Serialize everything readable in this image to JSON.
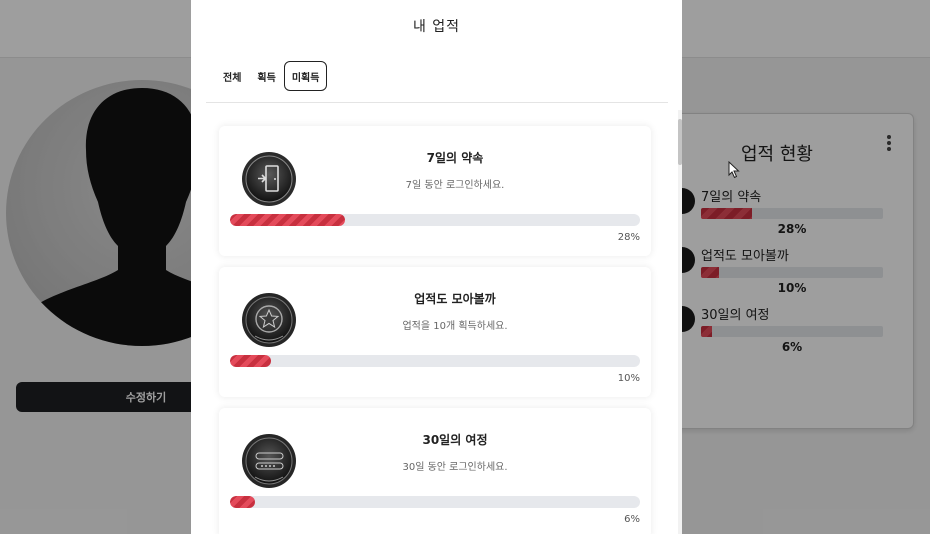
{
  "background": {
    "edit_button_label": "수정하기",
    "stats_card": {
      "title": "업적 현황",
      "menu_icon": "kebab-icon",
      "items": [
        {
          "label": "7일의 약속",
          "progress": 0.28,
          "percent_text": "28%"
        },
        {
          "label": "업적도 모아볼까",
          "progress": 0.1,
          "percent_text": "10%"
        },
        {
          "label": "30일의 여정",
          "progress": 0.06,
          "percent_text": "6%"
        }
      ]
    }
  },
  "modal": {
    "title": "내 업적",
    "tabs": [
      {
        "label": "전체",
        "active": false
      },
      {
        "label": "획득",
        "active": false
      },
      {
        "label": "미획득",
        "active": true
      }
    ],
    "achievements": [
      {
        "title": "7일의 약속",
        "description": "7일 동안 로그인하세요.",
        "progress": 0.28,
        "percent_text": "28%",
        "icon": "door-exit-badge-icon"
      },
      {
        "title": "업적도 모아볼까",
        "description": "업적을 10개 획득하세요.",
        "progress": 0.1,
        "percent_text": "10%",
        "icon": "star-badge-icon"
      },
      {
        "title": "30일의 여정",
        "description": "30일 동안 로그인하세요.",
        "progress": 0.06,
        "percent_text": "6%",
        "icon": "login-password-badge-icon"
      }
    ]
  },
  "colors": {
    "progress_fill": "#d93a49",
    "progress_track": "#e6e8ec",
    "overlay": "rgba(0,0,0,0.38)",
    "button_dark": "#1e1f22"
  }
}
